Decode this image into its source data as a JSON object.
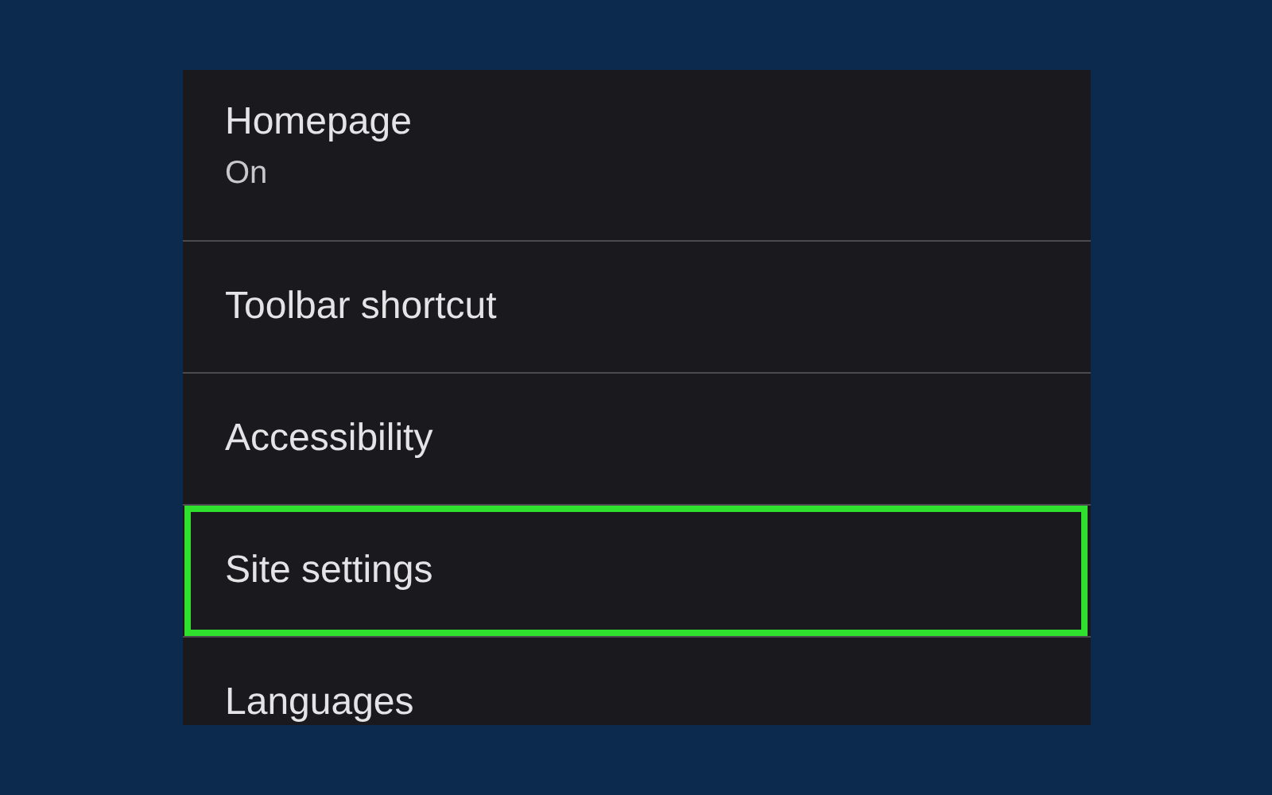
{
  "settings": [
    {
      "title": "Homepage",
      "summary": "On",
      "highlighted": false
    },
    {
      "title": "Toolbar shortcut",
      "highlighted": false
    },
    {
      "title": "Accessibility",
      "highlighted": false
    },
    {
      "title": "Site settings",
      "highlighted": true
    },
    {
      "title": "Languages",
      "highlighted": false
    }
  ]
}
